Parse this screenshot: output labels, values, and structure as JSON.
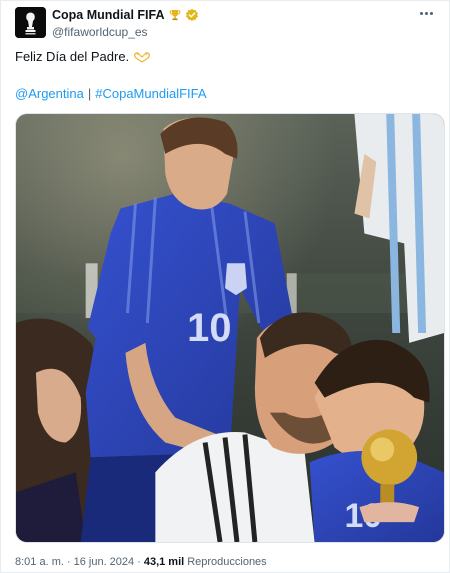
{
  "author": {
    "display_name": "Copa Mundial FIFA",
    "handle": "@fifaworldcup_es",
    "avatar_icon": "fifa-world-cup-logo",
    "badges": [
      "trophy-icon",
      "verified-icon"
    ]
  },
  "tweet": {
    "text": "Feliz Día del Padre.",
    "emoji": "heart-hands-icon",
    "links": [
      "@Argentina",
      "#CopaMundialFIFA"
    ],
    "separator": "|",
    "media_description_icon": "photo"
  },
  "meta": {
    "time": "8:01 a. m.",
    "dot": "·",
    "date": "16 jun. 2024",
    "views": "43,1 mil",
    "views_label": "Reproducciones"
  },
  "colors": {
    "link": "#1d9bf0",
    "muted": "#536471",
    "verified": "#e2b719",
    "shirt": "#2f4cc4"
  }
}
